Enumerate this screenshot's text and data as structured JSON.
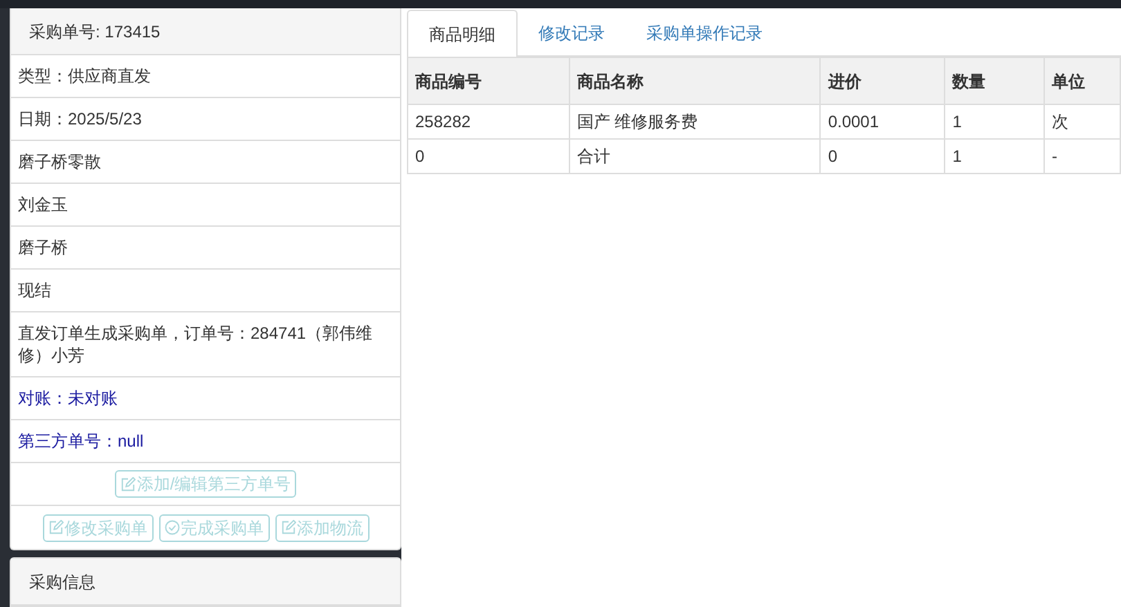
{
  "order_panel": {
    "title": "采购单号: 173415",
    "rows": [
      {
        "text": "类型：供应商直发",
        "kind": "plain"
      },
      {
        "text": "日期：2025/5/23",
        "kind": "plain"
      },
      {
        "text": "磨子桥零散",
        "kind": "plain"
      },
      {
        "text": "刘金玉",
        "kind": "plain"
      },
      {
        "text": "磨子桥",
        "kind": "plain"
      },
      {
        "text": "现结",
        "kind": "plain"
      },
      {
        "text": "直发订单生成采购单，订单号：284741（郭伟维修）小芳",
        "kind": "plain"
      },
      {
        "text": "对账：未对账",
        "kind": "accent"
      },
      {
        "text": "第三方单号：null",
        "kind": "accent"
      }
    ],
    "button_rows": [
      [
        {
          "label": "添加/编辑第三方单号",
          "kind": "edit",
          "disabled": true
        }
      ],
      [
        {
          "label": "修改采购单",
          "kind": "edit",
          "disabled": true
        },
        {
          "label": "完成采购单",
          "kind": "check",
          "disabled": true
        },
        {
          "label": "添加物流",
          "kind": "edit",
          "disabled": true
        }
      ]
    ]
  },
  "info_panel": {
    "title": "采购信息"
  },
  "tabs": [
    {
      "label": "商品明细",
      "selected": true
    },
    {
      "label": "修改记录",
      "selected": false
    },
    {
      "label": "采购单操作记录",
      "selected": false
    }
  ],
  "table": {
    "columns": [
      "商品编号",
      "商品名称",
      "进价",
      "数量",
      "单位"
    ],
    "rows": [
      [
        "258282",
        "国产 维修服务费",
        "0.0001",
        "1",
        "次"
      ],
      [
        "0",
        "合计",
        "0",
        "1",
        "-"
      ]
    ]
  }
}
